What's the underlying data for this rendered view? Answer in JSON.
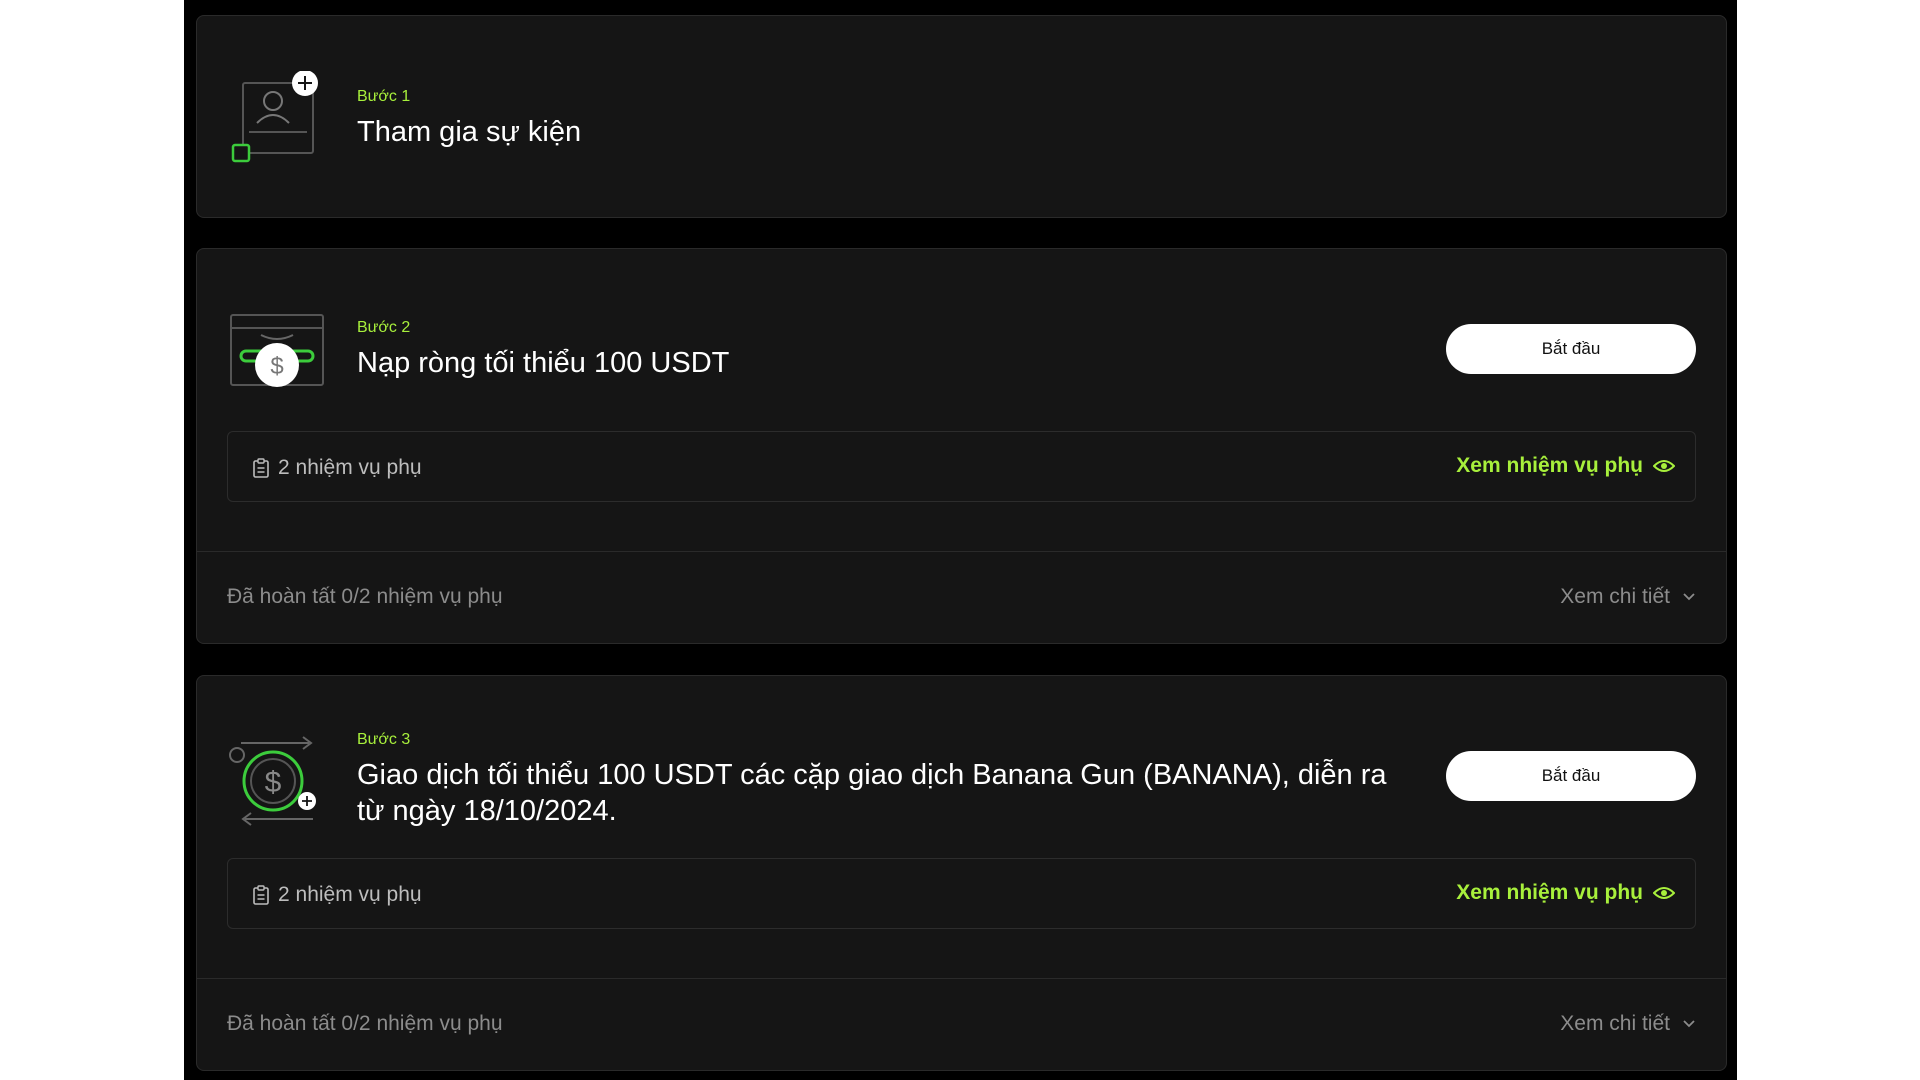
{
  "steps": [
    {
      "label": "Bước 1",
      "title": "Tham gia sự kiện",
      "icon": "user-profile-add-icon"
    },
    {
      "label": "Bước 2",
      "title": "Nạp ròng tối thiểu 100 USDT",
      "icon": "wallet-deposit-icon",
      "button": "Bắt đầu",
      "subtask_count": "2 nhiệm vụ phụ",
      "subtask_link": "Xem nhiệm vụ phụ",
      "progress": "Đã hoàn tất 0/2 nhiệm vụ phụ",
      "details": "Xem chi tiết"
    },
    {
      "label": "Bước 3",
      "title": "Giao dịch tối thiểu 100 USDT các cặp giao dịch Banana Gun (BANANA), diễn ra từ ngày 18/10/2024.",
      "icon": "coin-trade-icon",
      "button": "Bắt đầu",
      "subtask_count": "2 nhiệm vụ phụ",
      "subtask_link": "Xem nhiệm vụ phụ",
      "progress": "Đã hoàn tất 0/2 nhiệm vụ phụ",
      "details": "Xem chi tiết"
    }
  ],
  "colors": {
    "accent": "#a8f03c",
    "card": "#151515",
    "background": "#000000",
    "muted": "#8c8c8c"
  }
}
